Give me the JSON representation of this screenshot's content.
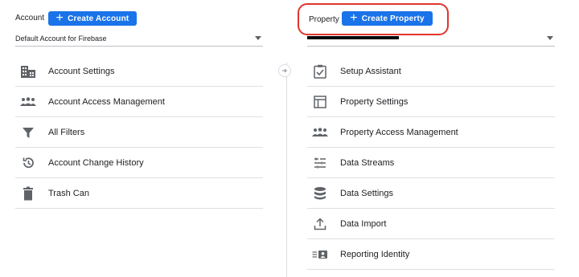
{
  "account": {
    "label": "Account",
    "create_button": "Create Account",
    "selected": "Default Account for Firebase",
    "items": [
      {
        "label": "Account Settings",
        "icon": "building-icon"
      },
      {
        "label": "Account Access Management",
        "icon": "people-icon"
      },
      {
        "label": "All Filters",
        "icon": "filter-icon"
      },
      {
        "label": "Account Change History",
        "icon": "history-icon"
      },
      {
        "label": "Trash Can",
        "icon": "trash-icon"
      }
    ]
  },
  "property": {
    "label": "Property",
    "create_button": "Create Property",
    "selected": "",
    "items": [
      {
        "label": "Setup Assistant",
        "icon": "clipboard-check-icon"
      },
      {
        "label": "Property Settings",
        "icon": "layout-icon"
      },
      {
        "label": "Property Access Management",
        "icon": "people-icon"
      },
      {
        "label": "Data Streams",
        "icon": "streams-icon"
      },
      {
        "label": "Data Settings",
        "icon": "database-icon"
      },
      {
        "label": "Data Import",
        "icon": "upload-icon"
      },
      {
        "label": "Reporting Identity",
        "icon": "identity-icon"
      }
    ]
  },
  "colors": {
    "accent": "#1a73e8",
    "highlight": "#e0342b",
    "icon": "#5f6368"
  }
}
